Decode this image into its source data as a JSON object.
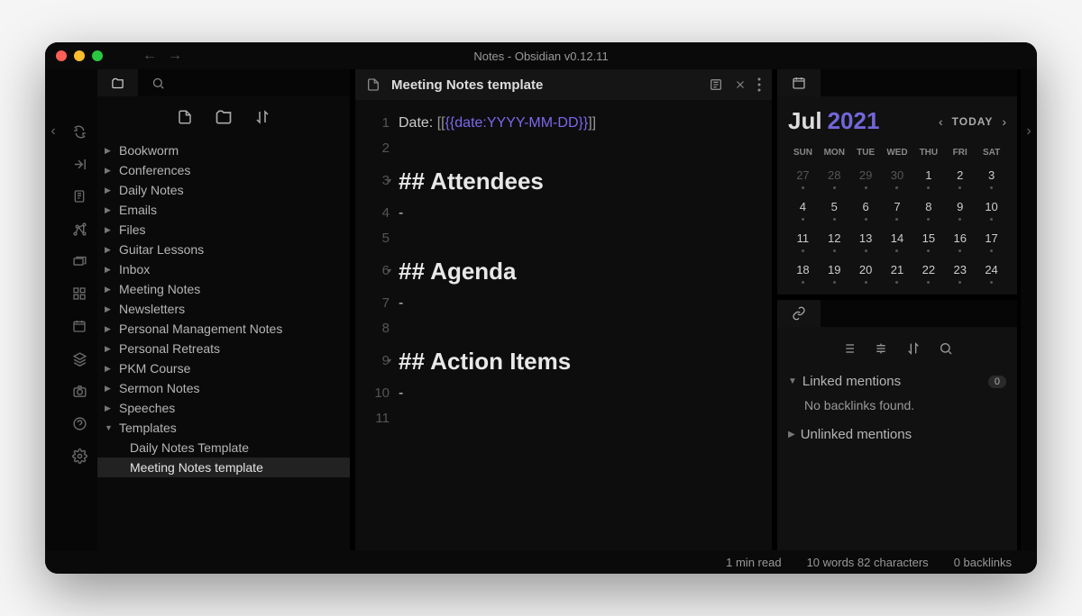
{
  "window": {
    "title": "Notes - Obsidian v0.12.11"
  },
  "tab": {
    "title": "Meeting Notes template"
  },
  "editor": {
    "date_prefix": "Date: ",
    "date_template_raw": "[[{{date:YYYY-MM-DD}}]]",
    "headings": {
      "attendees": "## Attendees",
      "agenda": "## Agenda",
      "action_items": "## Action Items"
    },
    "bullet": "-",
    "line_numbers": [
      "1",
      "2",
      "3",
      "4",
      "5",
      "6",
      "7",
      "8",
      "9",
      "10",
      "11"
    ]
  },
  "tree": [
    {
      "label": "Bookworm",
      "children": false
    },
    {
      "label": "Conferences",
      "children": false
    },
    {
      "label": "Daily Notes",
      "children": false
    },
    {
      "label": "Emails",
      "children": false
    },
    {
      "label": "Files",
      "children": false
    },
    {
      "label": "Guitar Lessons",
      "children": false
    },
    {
      "label": "Inbox",
      "children": false
    },
    {
      "label": "Meeting Notes",
      "children": false
    },
    {
      "label": "Newsletters",
      "children": false
    },
    {
      "label": "Personal Management Notes",
      "children": false
    },
    {
      "label": "Personal Retreats",
      "children": false
    },
    {
      "label": "PKM Course",
      "children": false
    },
    {
      "label": "Sermon Notes",
      "children": false
    },
    {
      "label": "Speeches",
      "children": false
    },
    {
      "label": "Templates",
      "expanded": true,
      "children": [
        {
          "label": "Daily Notes Template"
        },
        {
          "label": "Meeting Notes template",
          "selected": true
        }
      ]
    }
  ],
  "calendar": {
    "month": "Jul",
    "year": "2021",
    "today_label": "TODAY",
    "dow": [
      "SUN",
      "MON",
      "TUE",
      "WED",
      "THU",
      "FRI",
      "SAT"
    ],
    "weeks": [
      [
        {
          "d": "27",
          "dim": true,
          "dot": true
        },
        {
          "d": "28",
          "dim": true,
          "dot": true
        },
        {
          "d": "29",
          "dim": true,
          "dot": true
        },
        {
          "d": "30",
          "dim": true,
          "dot": true
        },
        {
          "d": "1",
          "dot": true
        },
        {
          "d": "2",
          "dot": true
        },
        {
          "d": "3",
          "dot": true
        }
      ],
      [
        {
          "d": "4",
          "dot": true
        },
        {
          "d": "5",
          "dot": true
        },
        {
          "d": "6",
          "dot": true
        },
        {
          "d": "7",
          "dot": true
        },
        {
          "d": "8",
          "dot": true
        },
        {
          "d": "9",
          "dot": true
        },
        {
          "d": "10",
          "dot": true
        }
      ],
      [
        {
          "d": "11",
          "dot": true
        },
        {
          "d": "12",
          "dot": true
        },
        {
          "d": "13",
          "dot": true
        },
        {
          "d": "14",
          "dot": true
        },
        {
          "d": "15",
          "dot": true
        },
        {
          "d": "16",
          "dot": true
        },
        {
          "d": "17",
          "dot": true
        }
      ],
      [
        {
          "d": "18",
          "dot": true
        },
        {
          "d": "19",
          "dot": true
        },
        {
          "d": "20",
          "dot": true
        },
        {
          "d": "21",
          "dot": true
        },
        {
          "d": "22",
          "dot": true
        },
        {
          "d": "23",
          "dot": true
        },
        {
          "d": "24",
          "dot": true
        }
      ]
    ]
  },
  "backlinks": {
    "linked_label": "Linked mentions",
    "linked_count": "0",
    "empty_text": "No backlinks found.",
    "unlinked_label": "Unlinked mentions"
  },
  "status": {
    "read_time": "1 min read",
    "word_count": "10 words 82 characters",
    "backlinks": "0 backlinks"
  }
}
